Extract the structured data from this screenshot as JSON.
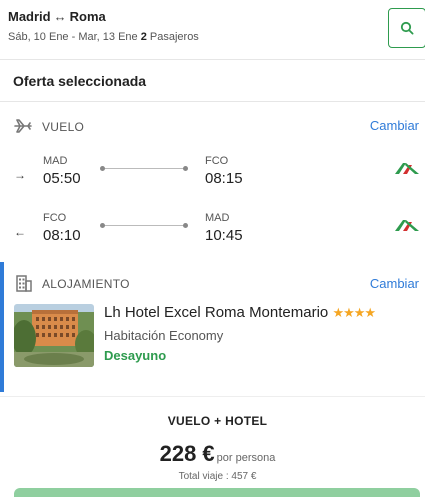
{
  "header": {
    "origin": "Madrid",
    "route_arrow": "↔",
    "destination": "Roma",
    "dates": "Sáb, 10 Ene - Mar, 13 Ene",
    "passengers_count": "2",
    "passengers_label": "Pasajeros",
    "search_icon": "search-icon"
  },
  "offer": {
    "title": "Oferta seleccionada"
  },
  "flight": {
    "label": "VUELO",
    "change_label": "Cambiar",
    "legs": [
      {
        "direction": "→",
        "from_code": "MAD",
        "from_time": "05:50",
        "to_code": "FCO",
        "to_time": "08:15",
        "airline_icon": "alitalia-logo"
      },
      {
        "direction": "←",
        "from_code": "FCO",
        "from_time": "08:10",
        "to_code": "MAD",
        "to_time": "10:45",
        "airline_icon": "alitalia-logo"
      }
    ]
  },
  "hotel": {
    "label": "ALOJAMIENTO",
    "change_label": "Cambiar",
    "name": "Lh Hotel Excel Roma Montemario",
    "stars": "★★★★",
    "stars_count": 4,
    "room": "Habitación Economy",
    "meal": "Desayuno"
  },
  "summary": {
    "bundle_label": "VUELO + HOTEL",
    "price": "228 €",
    "per_person": "por persona",
    "total": "Total viaje : 457 €"
  },
  "colors": {
    "accent_green": "#2e9b4e",
    "link_blue": "#2f7bd8",
    "star": "#f5a623"
  }
}
